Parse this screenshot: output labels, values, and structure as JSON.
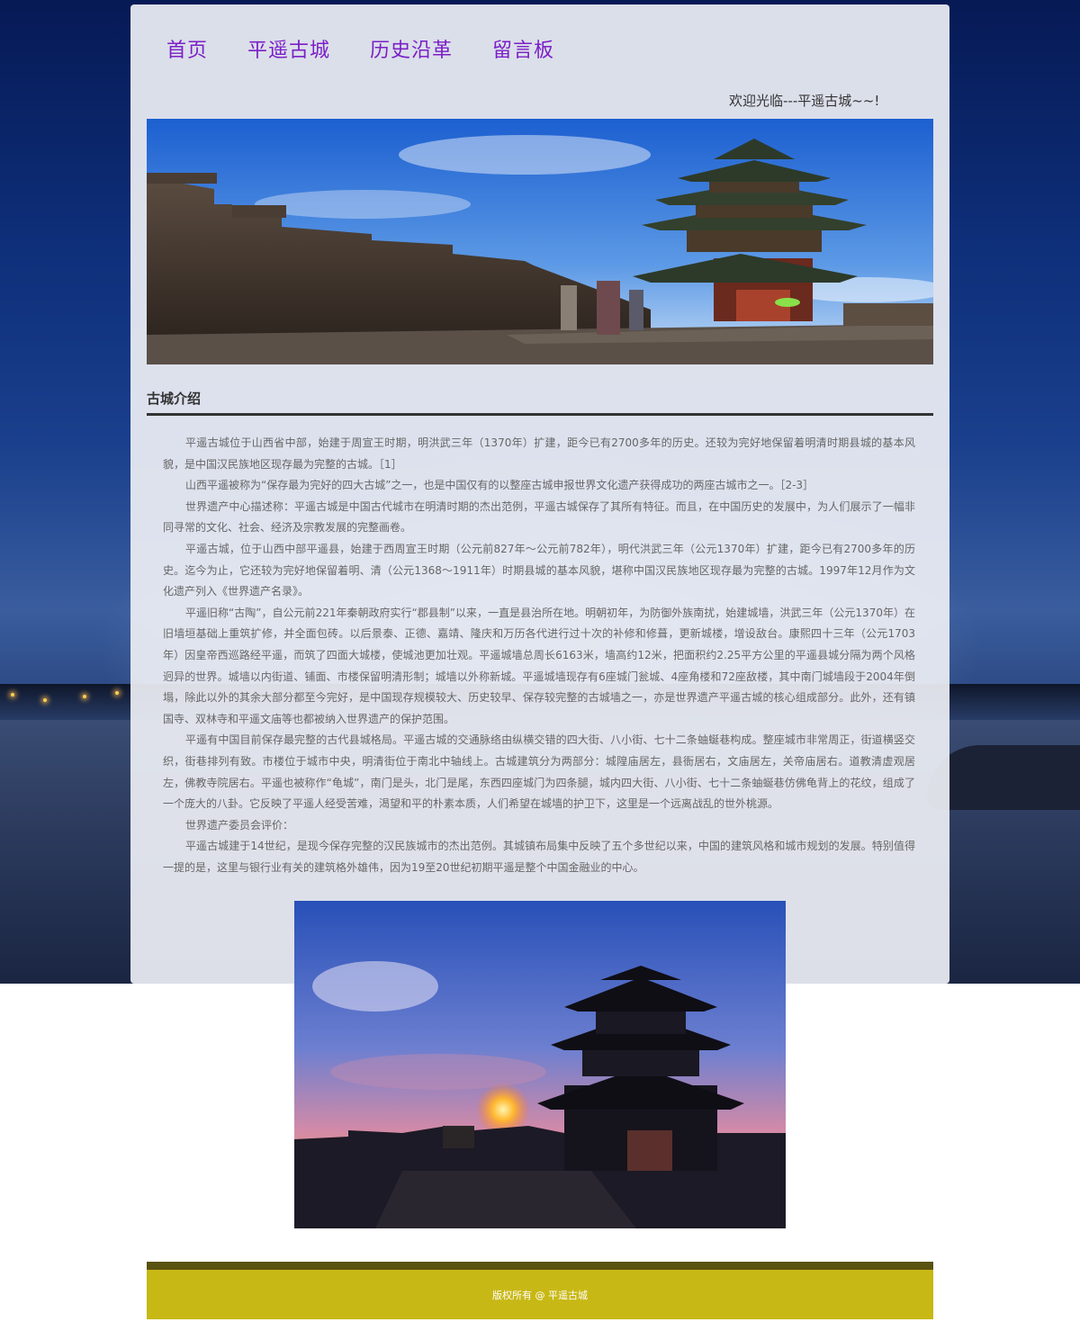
{
  "nav": {
    "items": [
      "首页",
      "平遥古城",
      "历史沿革",
      "留言板"
    ]
  },
  "welcome": "欢迎光临---平遥古城~~!",
  "section": {
    "title": "古城介绍"
  },
  "paragraphs": [
    "平遥古城位于山西省中部，始建于周宣王时期，明洪武三年（1370年）扩建，距今已有2700多年的历史。还较为完好地保留着明清时期县城的基本风貌，是中国汉民族地区现存最为完整的古城。［1］",
    "山西平遥被称为“保存最为完好的四大古城”之一，也是中国仅有的以整座古城申报世界文化遗产获得成功的两座古城市之一。［2-3］",
    "世界遗产中心描述称：平遥古城是中国古代城市在明清时期的杰出范例，平遥古城保存了其所有特征。而且，在中国历史的发展中，为人们展示了一幅非同寻常的文化、社会、经济及宗教发展的完整画卷。",
    "平遥古城，位于山西中部平遥县，始建于西周宣王时期（公元前827年～公元前782年），明代洪武三年（公元1370年）扩建，距今已有2700多年的历史。迄今为止，它还较为完好地保留着明、清（公元1368～1911年）时期县城的基本风貌，堪称中国汉民族地区现存最为完整的古城。1997年12月作为文化遗产列入《世界遗产名录》。",
    "平遥旧称“古陶”，自公元前221年秦朝政府实行“郡县制”以来，一直是县治所在地。明朝初年，为防御外族南扰，始建城墙，洪武三年（公元1370年）在旧墙垣基础上重筑扩修，并全面包砖。以后景泰、正德、嘉靖、隆庆和万历各代进行过十次的补修和修葺，更新城楼，增设敌台。康熙四十三年（公元1703年）因皇帝西巡路经平遥，而筑了四面大城楼，使城池更加壮观。平遥城墙总周长6163米，墙高约12米，把面积约2.25平方公里的平遥县城分隔为两个风格迥异的世界。城墙以内街道、铺面、市楼保留明清形制；城墙以外称新城。平遥城墙现存有6座城门瓮城、4座角楼和72座敌楼，其中南门城墙段于2004年倒塌，除此以外的其余大部分都至今完好，是中国现存规模较大、历史较早、保存较完整的古城墙之一，亦是世界遗产平遥古城的核心组成部分。此外，还有镇国寺、双林寺和平遥文庙等也都被纳入世界遗产的保护范围。",
    "平遥有中国目前保存最完整的古代县城格局。平遥古城的交通脉络由纵横交错的四大街、八小街、七十二条蚰蜒巷构成。整座城市非常周正，街道横竖交织，街巷排列有致。市楼位于城市中央，明清街位于南北中轴线上。古城建筑分为两部分：城隍庙居左，县衙居右，文庙居左，关帝庙居右。道教清虚观居左，佛教寺院居右。平遥也被称作“龟城”，南门是头，北门是尾，东西四座城门为四条腿，城内四大街、八小街、七十二条蚰蜒巷仿佛龟背上的花纹，组成了一个庞大的八卦。它反映了平遥人经受苦难，渴望和平的朴素本质，人们希望在城墙的护卫下，这里是一个远离战乱的世外桃源。",
    "世界遗产委员会评价：",
    "平遥古城建于14世纪，是现今保存完整的汉民族城市的杰出范例。其城镇布局集中反映了五个多世纪以来，中国的建筑风格和城市规划的发展。特别值得一提的是，这里与银行业有关的建筑格外雄伟，因为19至20世纪初期平遥是整个中国金融业的中心。"
  ],
  "footer": {
    "copyright": "版权所有 @ 平遥古城"
  }
}
